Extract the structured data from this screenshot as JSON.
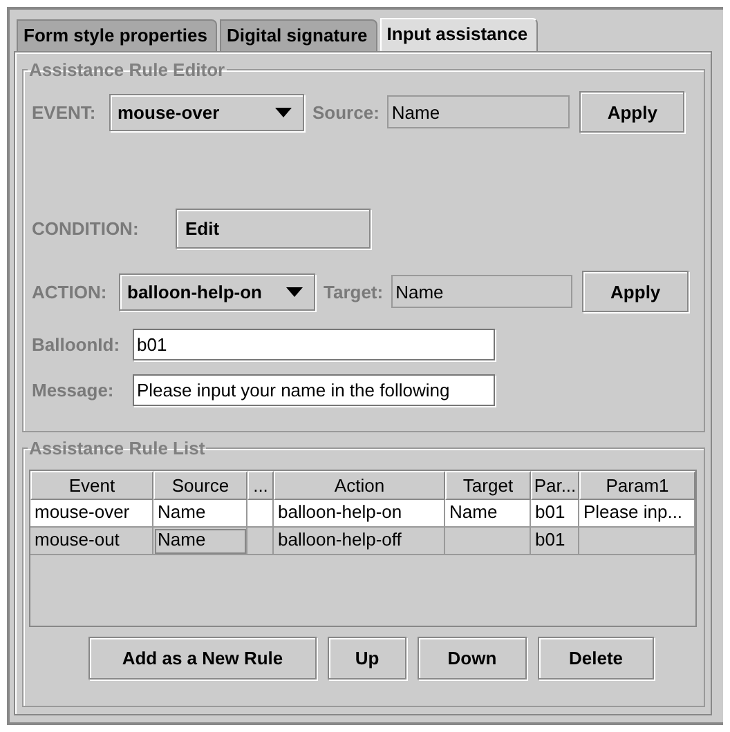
{
  "tabs": [
    {
      "label": "Form style properties",
      "selected": false
    },
    {
      "label": "Digital signature",
      "selected": false
    },
    {
      "label": "Input assistance",
      "selected": true
    }
  ],
  "editor": {
    "title": "Assistance Rule Editor",
    "event": {
      "label": "EVENT:",
      "value": "mouse-over",
      "source_label": "Source:",
      "source": "Name",
      "apply": "Apply"
    },
    "condition": {
      "label": "CONDITION:",
      "button": "Edit"
    },
    "action": {
      "label": "ACTION:",
      "value": "balloon-help-on",
      "target_label": "Target:",
      "target": "Name",
      "apply": "Apply"
    },
    "balloon_id": {
      "label": "BalloonId:",
      "value": "b01"
    },
    "message": {
      "label": "Message:",
      "value": "Please input your name in the following"
    }
  },
  "rule_list": {
    "title": "Assistance Rule List",
    "columns": [
      "Event",
      "Source",
      "...",
      "Action",
      "Target",
      "Par...",
      "Param1"
    ],
    "rows": [
      {
        "selected": true,
        "cells": [
          {
            "text": "mouse-over",
            "focused": false
          },
          {
            "text": "Name",
            "focused": false
          },
          {
            "focused": false
          },
          {
            "text": "balloon-help-on",
            "focused": false
          },
          {
            "text": "Name",
            "focused": false
          },
          {
            "text": "b01",
            "focused": false
          },
          {
            "text": "Please inp...",
            "focused": false
          }
        ]
      },
      {
        "selected": false,
        "cells": [
          {
            "text": "mouse-out",
            "focused": false
          },
          {
            "text": "Name",
            "focused": true
          },
          {
            "focused": false
          },
          {
            "text": "balloon-help-off",
            "focused": false
          },
          {
            "focused": false
          },
          {
            "text": "b01",
            "focused": false
          },
          {
            "focused": false
          }
        ]
      }
    ],
    "buttons": [
      "Add as a New Rule",
      "Up",
      "Down",
      "Delete"
    ]
  }
}
